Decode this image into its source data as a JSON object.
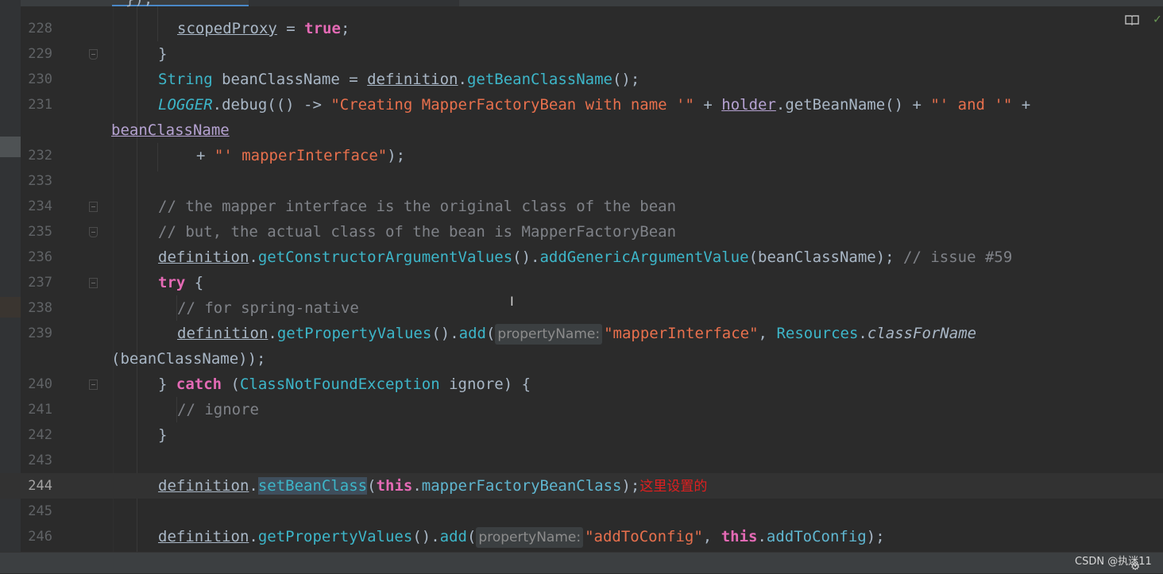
{
  "editor": {
    "partial_top": "});",
    "watermark": "CSDN @执迷11",
    "icons": {
      "reader_mode": "book-icon",
      "inspection_ok": "check-icon",
      "settings": "gear-icon",
      "text_cursor": "i-beam-cursor-icon"
    },
    "colors": {
      "background": "#2b2b2b",
      "keyword": "#e46ab5",
      "string": "#e8704d",
      "comment": "#7f8288",
      "method": "#3db6c9",
      "annotation": "#e01f1f"
    }
  },
  "lines": {
    "l228": {
      "num": "228",
      "f1": "scopedProxy",
      "t1": " = ",
      "k1": "true",
      "t2": ";"
    },
    "l229": {
      "num": "229",
      "t1": "}"
    },
    "l230": {
      "num": "230",
      "c1": "String",
      "t1": " beanClassName = ",
      "u1": "definition",
      "t2": ".",
      "m1": "getBeanClassName",
      "t3": "();"
    },
    "l231": {
      "num": "231",
      "s1": "LOGGER",
      "t1": ".debug(() -> ",
      "str1": "\"Creating MapperFactoryBean with name '\"",
      "t2": " + ",
      "v1": "holder",
      "t3": ".getBeanName() + ",
      "str2": "\"' and '\"",
      "t4": " +"
    },
    "l231b": {
      "v1": "beanClassName"
    },
    "l232": {
      "num": "232",
      "t1": "+ ",
      "str1": "\"' mapperInterface\"",
      "t2": ");"
    },
    "l233": {
      "num": "233"
    },
    "l234": {
      "num": "234",
      "cm1": "// the mapper interface is the original class of the bean"
    },
    "l235": {
      "num": "235",
      "cm1": "// but, the actual class of the bean is MapperFactoryBean"
    },
    "l236": {
      "num": "236",
      "u1": "definition",
      "t1": ".",
      "m1": "getConstructorArgumentValues",
      "t2": "().",
      "m2": "addGenericArgumentValue",
      "t3": "(beanClassName); ",
      "cm1": "// issue #59"
    },
    "l237": {
      "num": "237",
      "k1": "try",
      "t1": " {"
    },
    "l238": {
      "num": "238",
      "cm1": "// for spring-native"
    },
    "l239": {
      "num": "239",
      "u1": "definition",
      "t1": ".",
      "m1": "getPropertyValues",
      "t2": "().",
      "m2": "add",
      "t3": "(",
      "h1": "propertyName:",
      "str1": "\"mapperInterface\"",
      "t4": ", ",
      "c1": "Resources",
      "t5": ".",
      "s1": "classForName"
    },
    "l239b": {
      "t1": "(beanClassName));"
    },
    "l240": {
      "num": "240",
      "t1": "} ",
      "k1": "catch",
      "t2": " (",
      "c1": "ClassNotFoundException",
      "t3": " ignore) {"
    },
    "l241": {
      "num": "241",
      "cm1": "// ignore"
    },
    "l242": {
      "num": "242",
      "t1": "}"
    },
    "l243": {
      "num": "243"
    },
    "l244": {
      "num": "244",
      "u1": "definition",
      "t1": ".",
      "m1": "setBeanClass",
      "t2": "(",
      "k1": "this",
      "t3": ".",
      "f1": "mapperFactoryBeanClass",
      "t4": ");",
      "a1": "这里设置的"
    },
    "l245": {
      "num": "245"
    },
    "l246": {
      "num": "246",
      "u1": "definition",
      "t1": ".",
      "m1": "getPropertyValues",
      "t2": "().",
      "m2": "add",
      "t3": "(",
      "h1": "propertyName:",
      "str1": "\"addToConfig\"",
      "t4": ", ",
      "k1": "this",
      "t5": ".",
      "f1": "addToConfig",
      "t6": ");"
    }
  }
}
